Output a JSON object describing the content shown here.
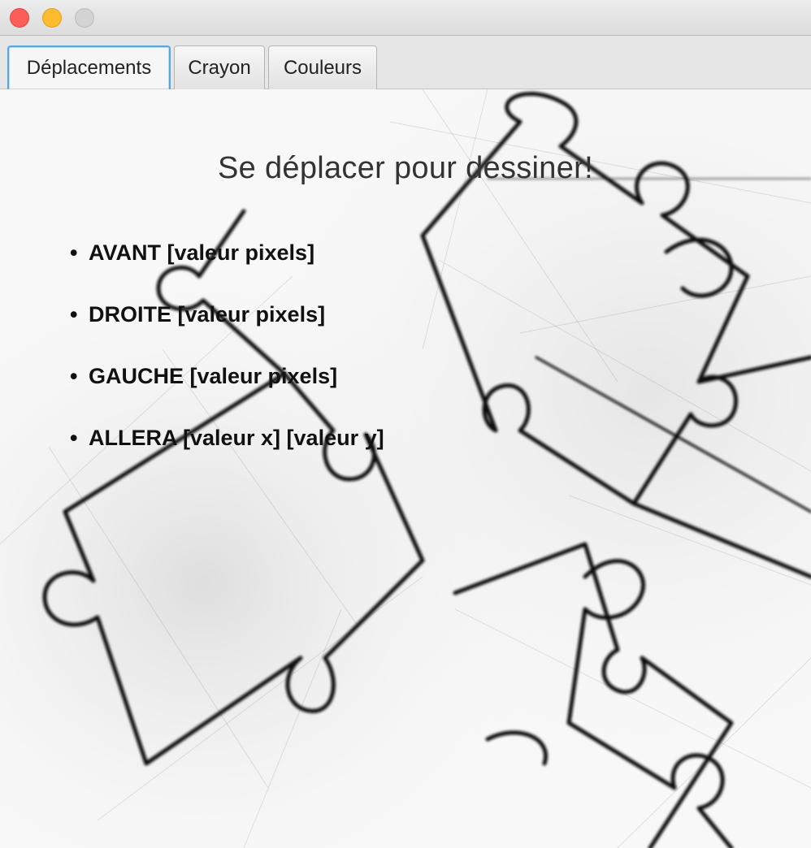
{
  "window": {
    "controls": {
      "close": "close-icon",
      "minimize": "minimize-icon",
      "zoom": "zoom-icon"
    }
  },
  "tabs": [
    {
      "label": "Déplacements",
      "selected": true
    },
    {
      "label": "Crayon",
      "selected": false
    },
    {
      "label": "Couleurs",
      "selected": false
    }
  ],
  "main": {
    "heading": "Se déplacer pour dessiner!",
    "bullet": "•",
    "commands": [
      "AVANT [valeur pixels]",
      "DROITE [valeur pixels]",
      "GAUCHE [valeur pixels]",
      "ALLERA [valeur x] [valeur y]"
    ]
  },
  "colors": {
    "selected_tab_border": "#5aa7e0",
    "close": "#fc5f57",
    "minimize": "#fdbc2e",
    "zoom_disabled": "#d3d3d3"
  }
}
